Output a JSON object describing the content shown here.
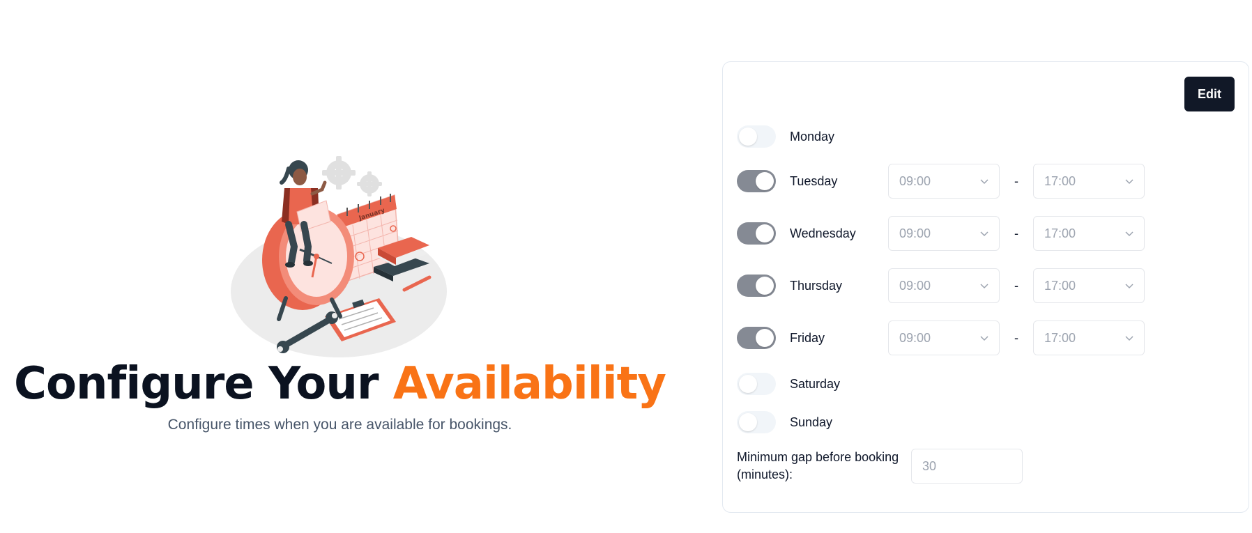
{
  "hero": {
    "title_main": "Configure Your ",
    "title_accent": "Availability",
    "subtitle": "Configure times when you are available for bookings.",
    "calendar_month": "January",
    "accent_color": "#f97316"
  },
  "card": {
    "edit_label": "Edit",
    "dash": "-",
    "days": [
      {
        "label": "Monday",
        "enabled": false
      },
      {
        "label": "Tuesday",
        "enabled": true,
        "start": "09:00",
        "end": "17:00"
      },
      {
        "label": "Wednesday",
        "enabled": true,
        "start": "09:00",
        "end": "17:00"
      },
      {
        "label": "Thursday",
        "enabled": true,
        "start": "09:00",
        "end": "17:00"
      },
      {
        "label": "Friday",
        "enabled": true,
        "start": "09:00",
        "end": "17:00"
      },
      {
        "label": "Saturday",
        "enabled": false
      },
      {
        "label": "Sunday",
        "enabled": false
      }
    ],
    "min_gap_label": "Minimum gap before booking (minutes):",
    "min_gap_placeholder": "30"
  }
}
